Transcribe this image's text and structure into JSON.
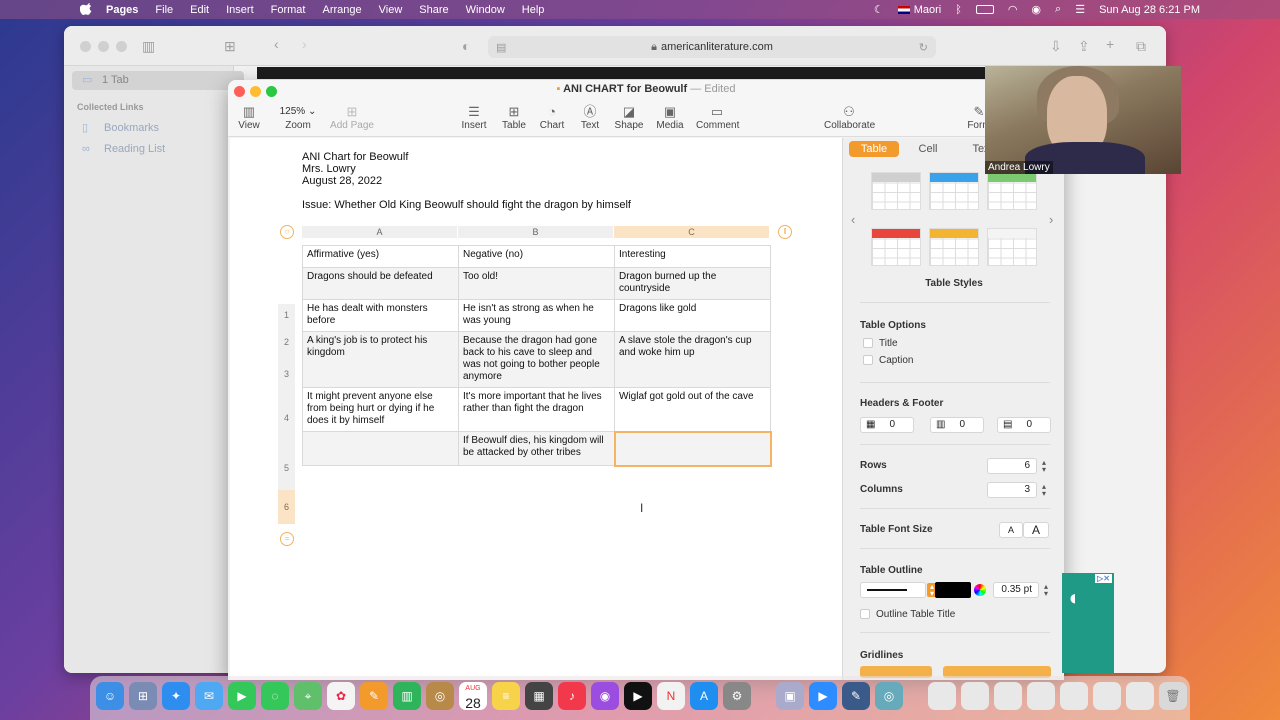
{
  "menubar": {
    "app": "Pages",
    "items": [
      "File",
      "Edit",
      "Insert",
      "Format",
      "Arrange",
      "View",
      "Share",
      "Window",
      "Help"
    ],
    "keyboard": "Maori",
    "datetime": "Sun Aug 28  6:21 PM"
  },
  "safari": {
    "url": "americanliterature.com",
    "sidebar": {
      "tabs": "1 Tab",
      "header": "Collected Links",
      "links": [
        "Bookmarks",
        "Reading List"
      ]
    }
  },
  "pages": {
    "title": "ANI CHART for Beowulf",
    "status": "— Edited",
    "toolbar": {
      "view": "View",
      "zoom_value": "125%",
      "zoom": "Zoom",
      "add_page": "Add Page",
      "insert": "Insert",
      "table": "Table",
      "chart": "Chart",
      "text": "Text",
      "shape": "Shape",
      "media": "Media",
      "comment": "Comment",
      "collaborate": "Collaborate",
      "format": "Form"
    },
    "doc": {
      "heading": "ANI Chart for Beowulf",
      "author": "Mrs. Lowry",
      "date": "August 28, 2022",
      "issue": "Issue:  Whether Old King Beowulf should fight the dragon by himself"
    },
    "table": {
      "columns": [
        "A",
        "B",
        "C"
      ],
      "rows": [
        {
          "n": "1",
          "cells": [
            "Affirmative (yes)",
            "Negative (no)",
            "Interesting"
          ]
        },
        {
          "n": "2",
          "cells": [
            "Dragons should be defeated",
            "Too old!",
            "Dragon burned up the countryside"
          ]
        },
        {
          "n": "3",
          "cells": [
            "He has dealt with monsters before",
            "He isn't as strong as when he was young",
            "Dragons like gold"
          ]
        },
        {
          "n": "4",
          "cells": [
            "A king's job is to protect his kingdom",
            "Because the dragon had gone back to his cave to sleep and was not going to bother people anymore",
            "A slave stole the dragon's cup and woke him up"
          ]
        },
        {
          "n": "5",
          "cells": [
            "It might prevent anyone else from being hurt or dying if he does it by himself",
            "It's more important that he lives rather than fight the dragon",
            "Wiglaf got gold out of the cave"
          ]
        },
        {
          "n": "6",
          "cells": [
            "",
            "If Beowulf dies, his kingdom will be attacked by other tribes",
            ""
          ]
        }
      ]
    },
    "inspector": {
      "tabs": [
        "Table",
        "Cell",
        "Tex"
      ],
      "styles_label": "Table Styles",
      "table_options": "Table Options",
      "title_opt": "Title",
      "caption_opt": "Caption",
      "headers_footer": "Headers & Footer",
      "header_rows": "0",
      "header_cols": "0",
      "footer_rows": "0",
      "rows_label": "Rows",
      "rows": "6",
      "columns_label": "Columns",
      "columns": "3",
      "font_size_label": "Table Font Size",
      "font_small": "A",
      "font_large": "A",
      "outline_label": "Table Outline",
      "outline_width": "0.35 pt",
      "outline_title": "Outline Table Title",
      "gridlines": "Gridlines"
    }
  },
  "webcam": {
    "name": "Andrea Lowry"
  },
  "dock": {
    "calendar_day": "28",
    "calendar_month": "AUG"
  },
  "colors": {
    "accent": "#f39a2c",
    "selection": "#f6b462"
  }
}
